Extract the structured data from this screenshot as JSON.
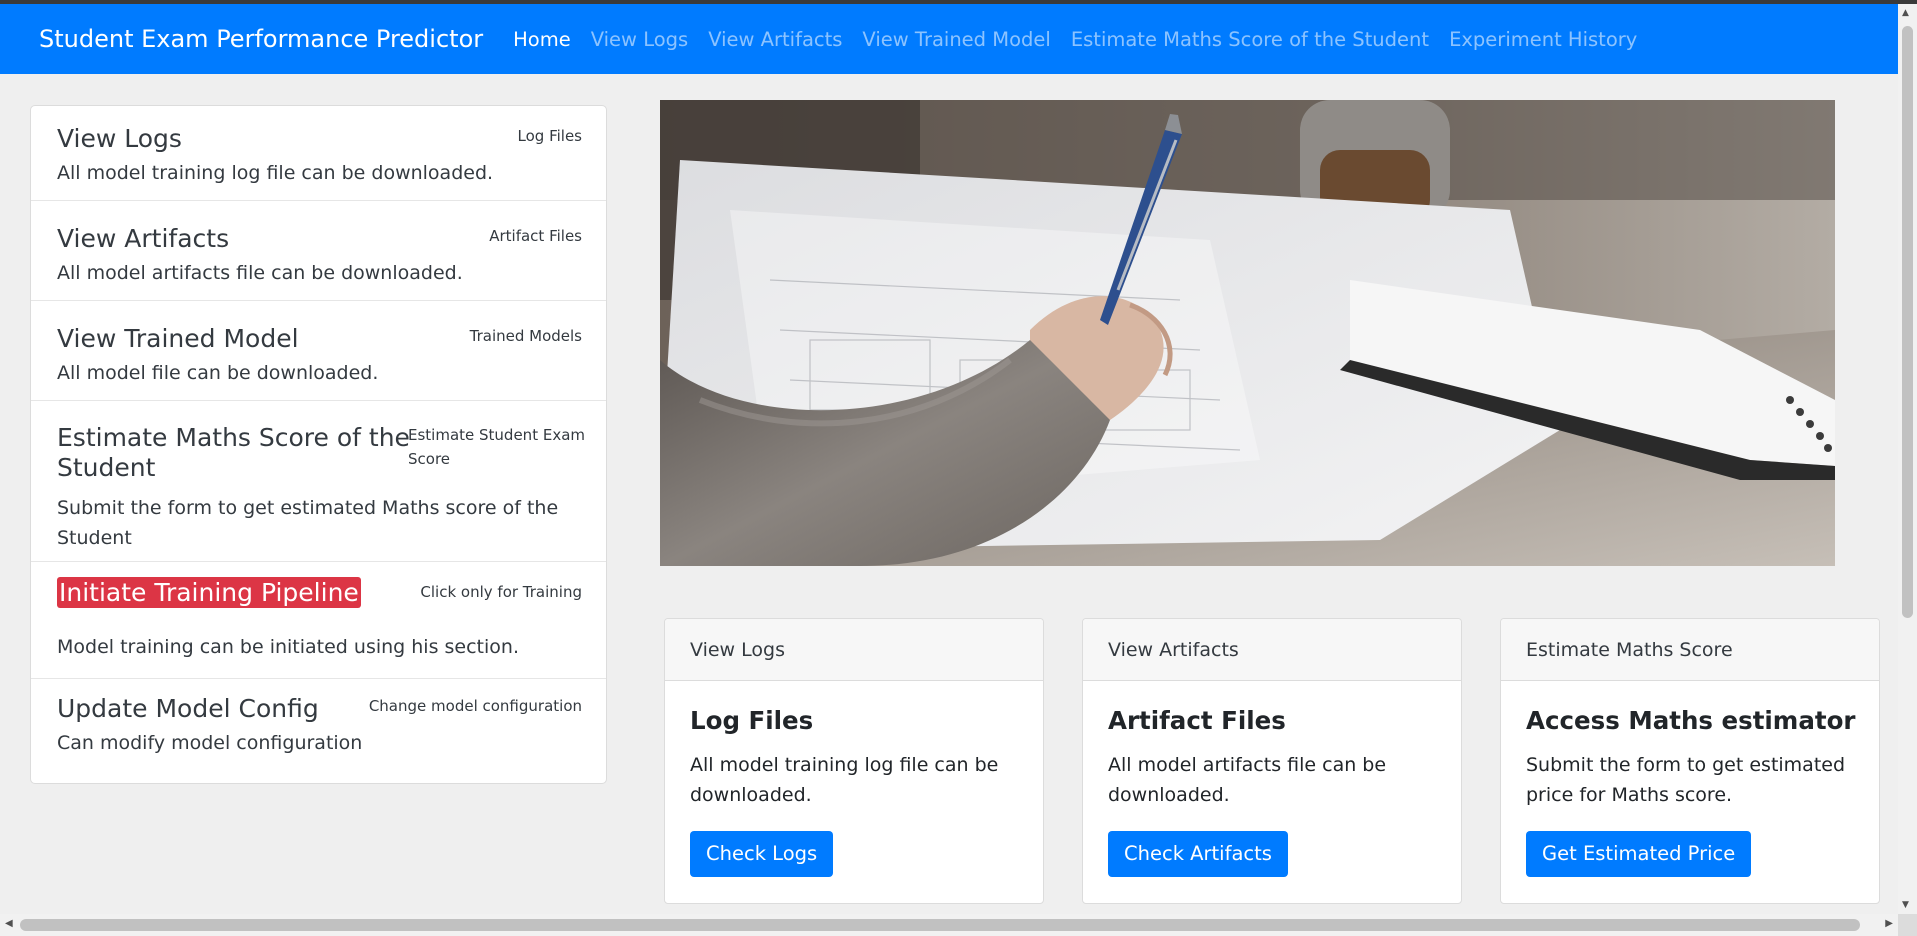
{
  "navbar": {
    "brand": "Student Exam Performance Predictor",
    "links": [
      "Home",
      "View Logs",
      "View Artifacts",
      "View Trained Model",
      "Estimate Maths Score of the Student",
      "Experiment History"
    ],
    "active_link": "Home",
    "color": "#007bff"
  },
  "sidebar": {
    "items": [
      {
        "title": "View Logs",
        "tag": "Log Files",
        "text": "All model training log file can be downloaded."
      },
      {
        "title": "View Artifacts",
        "tag": "Artifact Files",
        "text": "All model artifacts file can be downloaded."
      },
      {
        "title": "View Trained Model",
        "tag": "Trained Models",
        "text": "All model file can be downloaded."
      },
      {
        "title_line1": "Estimate Maths Score of the",
        "title_line2": "Student",
        "tag_line1": "Estimate Student Exam",
        "tag_line2": "Score",
        "text_line1": "Submit the form to get estimated Maths score of the",
        "text_line2": "Student"
      },
      {
        "title": "Initiate Training Pipeline",
        "tag": "Click only for Training",
        "text": "Model training can be initiated using his section.",
        "highlight_color": "#dc3545"
      },
      {
        "title": "Update Model Config",
        "tag": "Change model configuration",
        "text": "Can modify model configuration"
      }
    ]
  },
  "hero_image": {
    "icon": "student-writing-photo"
  },
  "cards": [
    {
      "header": "View Logs",
      "title": "Log Files",
      "text": "All model training log file can be downloaded.",
      "button": "Check Logs"
    },
    {
      "header": "View Artifacts",
      "title": "Artifact Files",
      "text": "All model artifacts file can be downloaded.",
      "button": "Check Artifacts"
    },
    {
      "header": "Estimate Maths Score",
      "title": "Access Maths estimator",
      "text": "Submit the form to get estimated price for Maths score.",
      "button": "Get Estimated Price"
    }
  ]
}
